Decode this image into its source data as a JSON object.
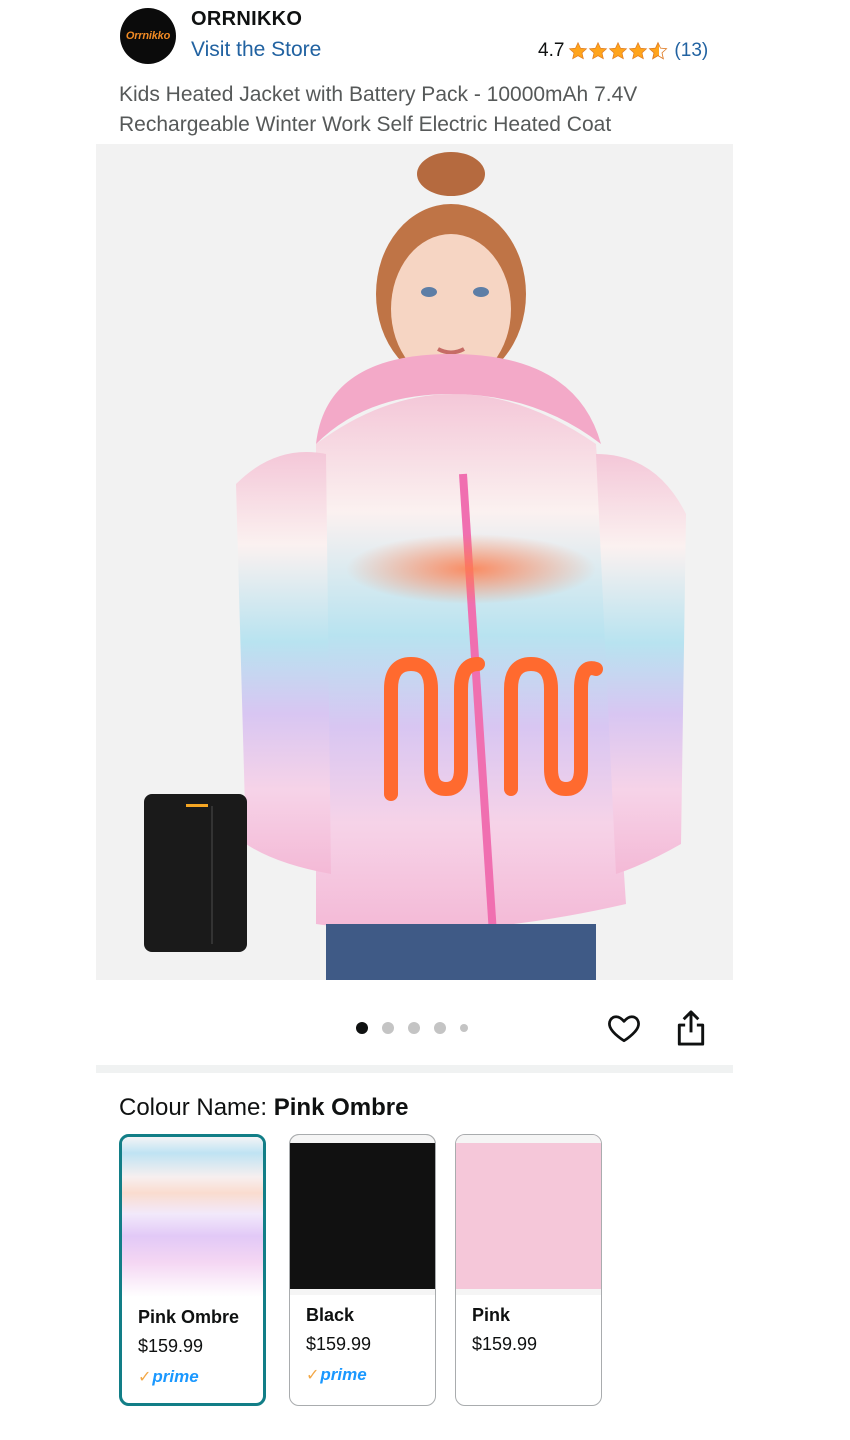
{
  "brand": {
    "logo_text": "Orrnikko",
    "name": "ORRNIKKO",
    "store_link": "Visit the Store"
  },
  "rating": {
    "score": "4.7",
    "stars_value": 4.7,
    "count": "(13)"
  },
  "product": {
    "title": "Kids Heated Jacket with Battery Pack - 10000mAh 7.4V Rechargeable Winter Work Self Electric Heated Coat",
    "image_icon": "kid-pink-ombre-heated-jacket-image"
  },
  "carousel": {
    "total": 5,
    "active_index": 0
  },
  "colour": {
    "label": "Colour Name:",
    "selected": "Pink Ombre"
  },
  "swatches": [
    {
      "name": "Pink Ombre",
      "price": "$159.99",
      "prime": "prime",
      "selected": true
    },
    {
      "name": "Black",
      "price": "$159.99",
      "prime": "prime",
      "selected": false
    },
    {
      "name": "Pink",
      "price": "$159.99",
      "prime": "",
      "selected": false
    }
  ],
  "colors": {
    "link": "#2162a1",
    "star": "#ffa41c",
    "selected_border": "#127e87",
    "prime_blue": "#1a98ff",
    "prime_check": "#f3a847"
  }
}
